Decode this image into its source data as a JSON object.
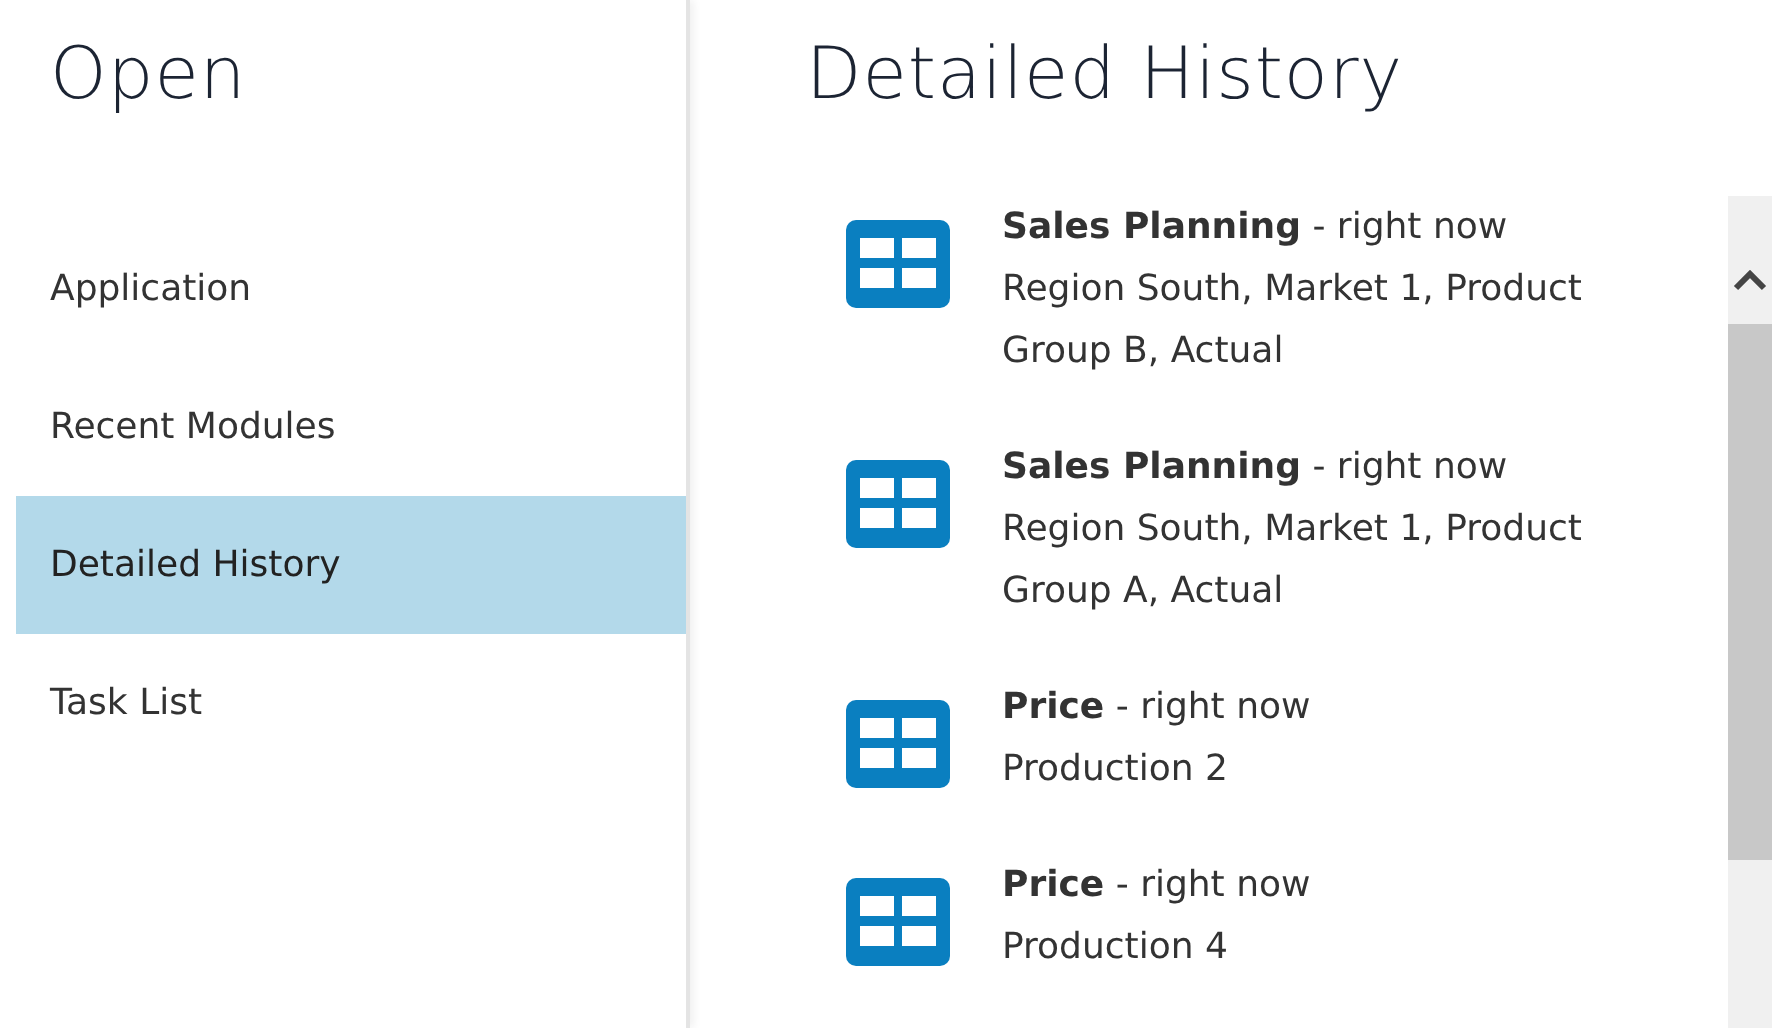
{
  "sidebar": {
    "title": "Open",
    "items": [
      {
        "label": "Application",
        "selected": false
      },
      {
        "label": "Recent Modules",
        "selected": false
      },
      {
        "label": "Detailed History",
        "selected": true
      },
      {
        "label": "Task List",
        "selected": false
      }
    ]
  },
  "main": {
    "title": "Detailed History",
    "history": [
      {
        "heading": "**Sales Planning** - right now",
        "detail": "Region South, Market 1, Product Group B, Actual"
      },
      {
        "heading": "**Sales Planning** - right now",
        "detail": "Region South, Market 1, Product Group A, Actual"
      },
      {
        "heading": "**Price** - right now",
        "detail": "Production 2"
      },
      {
        "heading": "**Price** - right now",
        "detail": "Production 4"
      }
    ]
  }
}
